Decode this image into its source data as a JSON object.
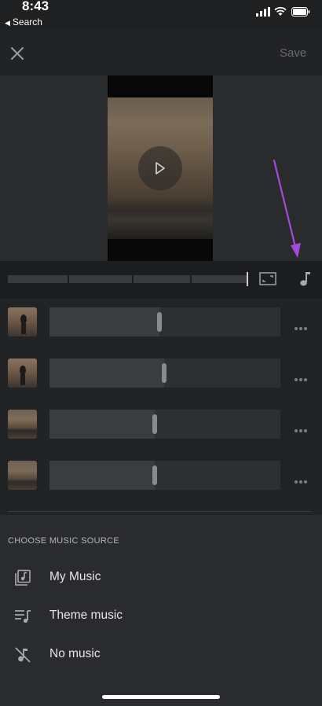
{
  "status_bar": {
    "time": "8:43",
    "back_label": "Search",
    "back_icon": "back-triangle-icon"
  },
  "app_bar": {
    "close_icon": "close-icon",
    "save_label": "Save"
  },
  "preview": {
    "play_icon": "play-icon"
  },
  "timeline": {
    "fit_icon": "fit-screen-icon",
    "music_icon": "music-note-icon"
  },
  "clips": [
    {
      "name": "clip-1"
    },
    {
      "name": "clip-2"
    },
    {
      "name": "clip-3"
    },
    {
      "name": "clip-4"
    }
  ],
  "music_source": {
    "heading": "CHOOSE MUSIC SOURCE",
    "options": [
      {
        "label": "My Music",
        "icon": "music-library-icon"
      },
      {
        "label": "Theme music",
        "icon": "playlist-icon"
      },
      {
        "label": "No music",
        "icon": "music-off-icon"
      }
    ]
  },
  "colors": {
    "background": "#222325",
    "sheet": "#2a2b2e",
    "annotation_arrow": "#a24bd9"
  }
}
